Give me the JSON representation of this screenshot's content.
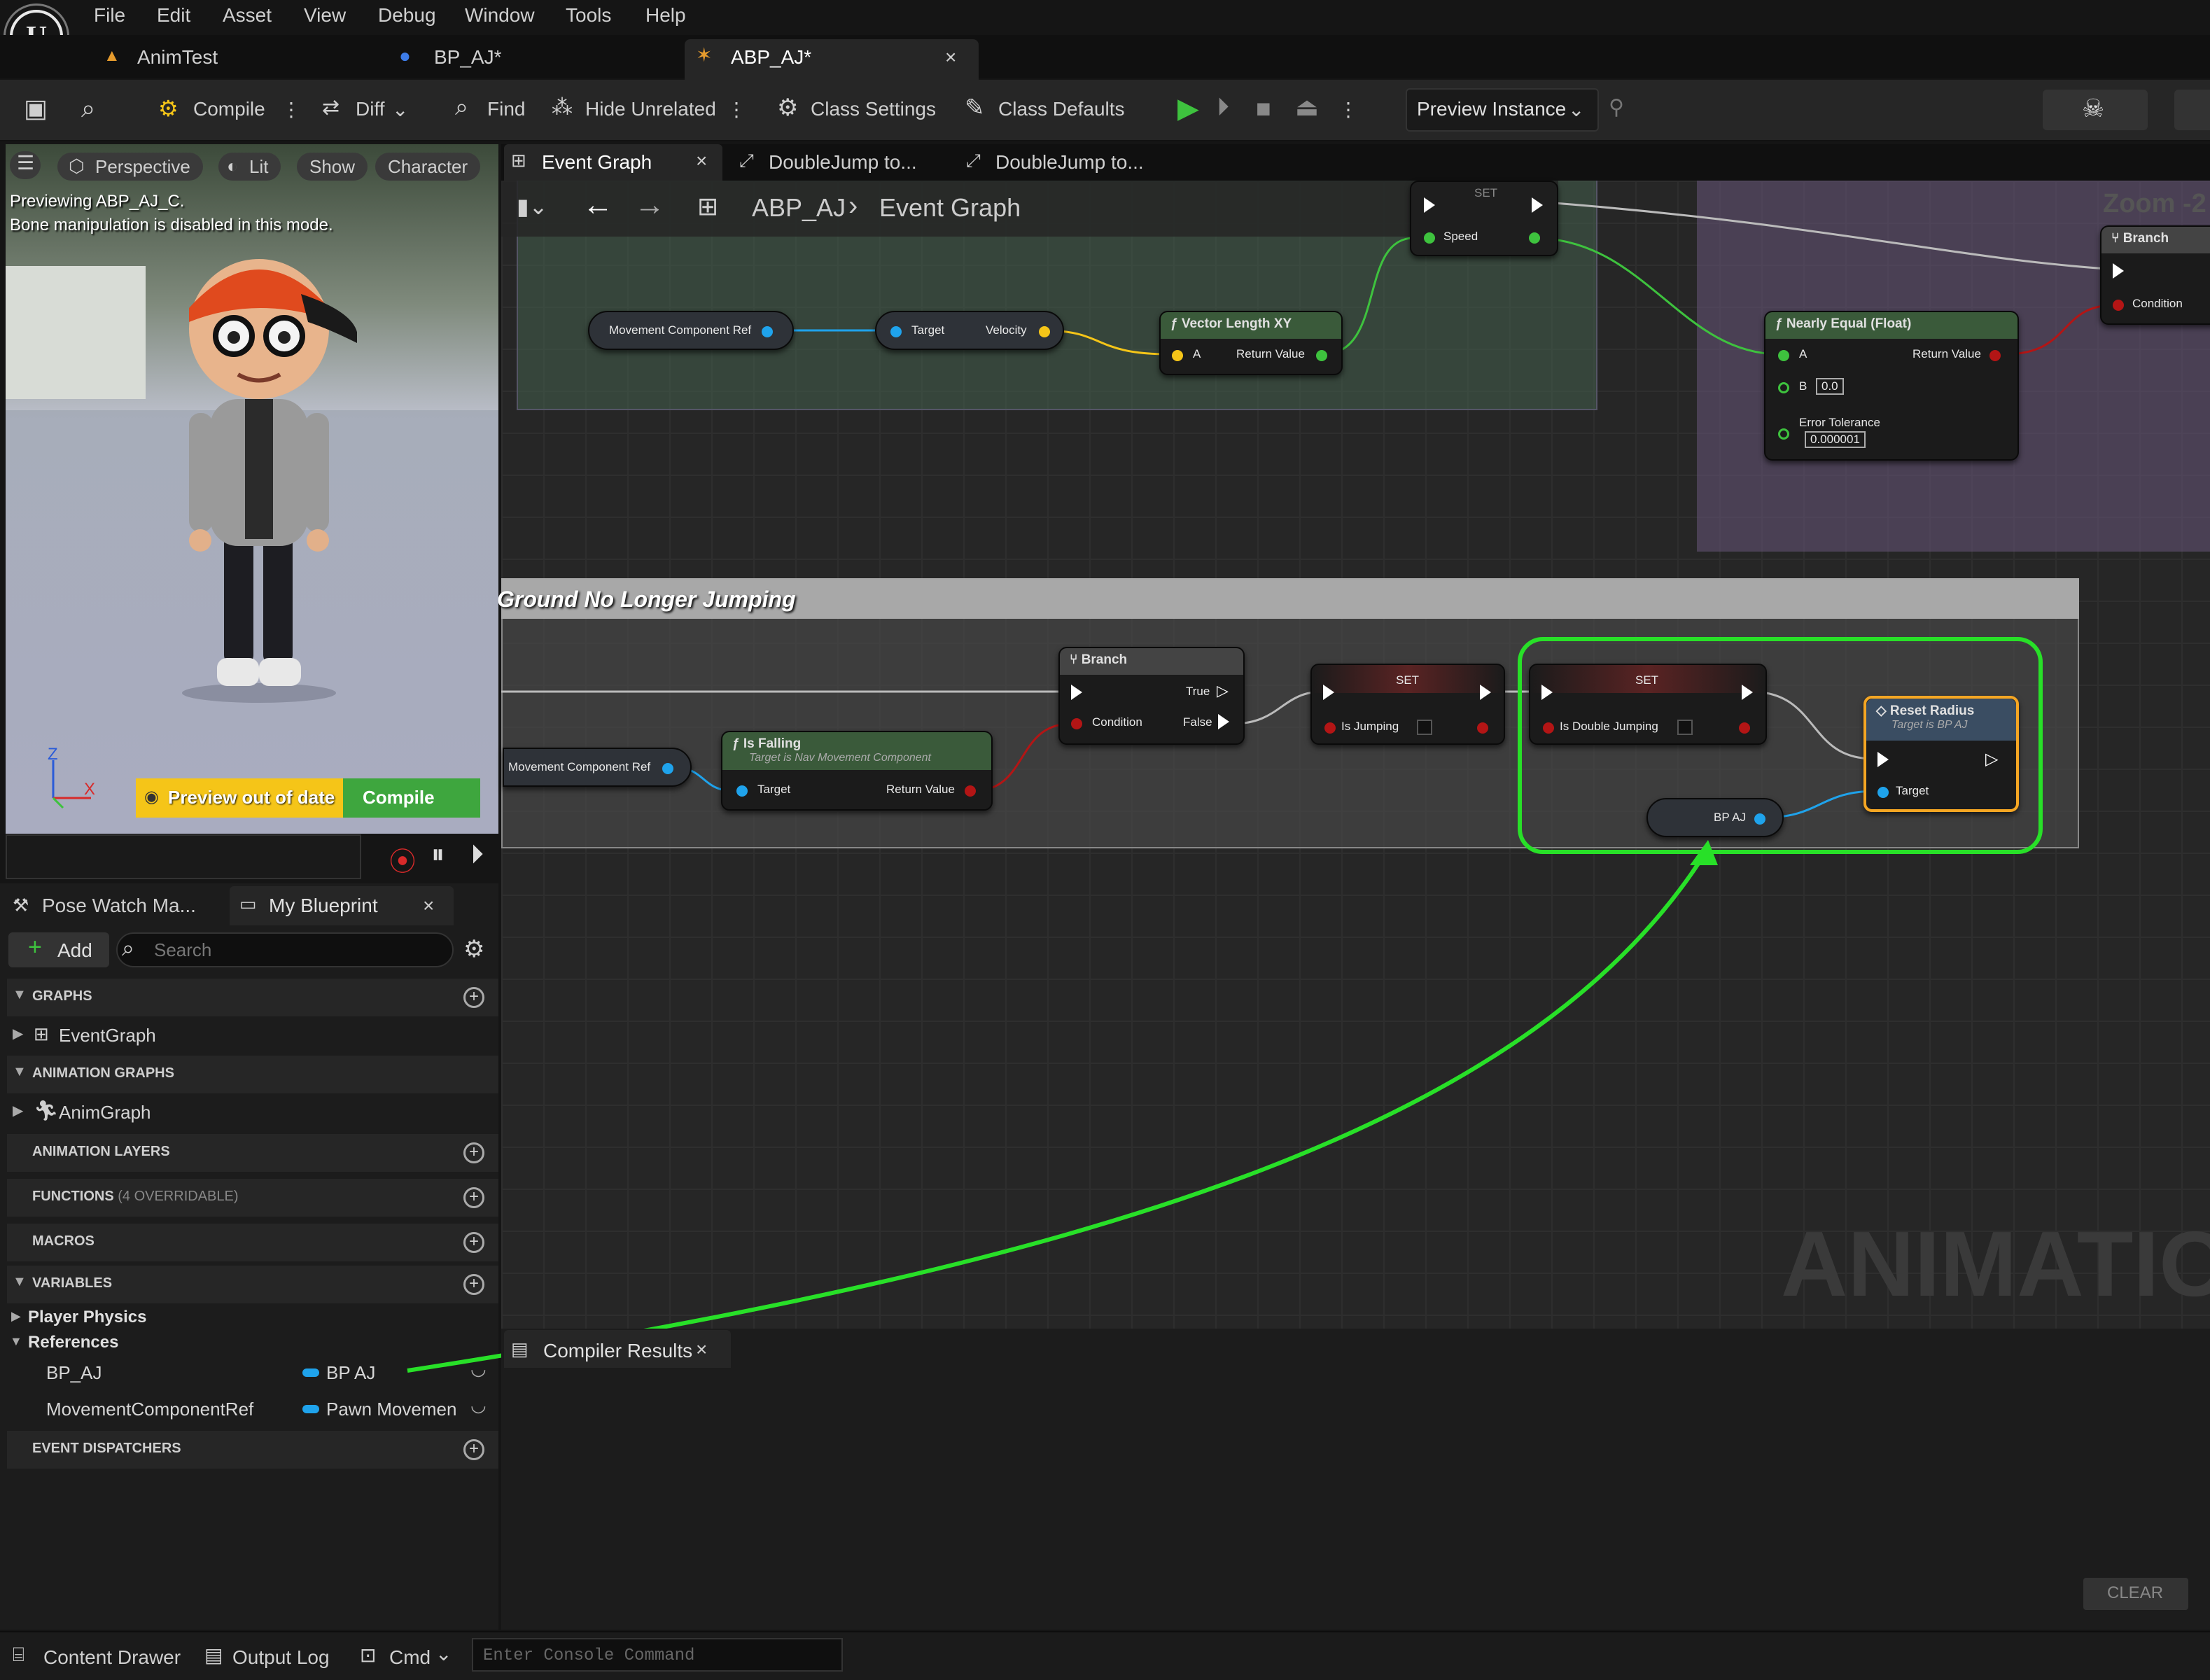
{
  "menu": [
    "File",
    "Edit",
    "Asset",
    "View",
    "Debug",
    "Window",
    "Tools",
    "Help"
  ],
  "doc_tabs": [
    {
      "label": "AnimTest",
      "close": ""
    },
    {
      "label": "BP_AJ*",
      "close": ""
    },
    {
      "label": "ABP_AJ*",
      "close": "×"
    }
  ],
  "toolbar": {
    "compile": "Compile",
    "diff": "Diff",
    "find": "Find",
    "hide_unrelated": "Hide Unrelated",
    "class_settings": "Class Settings",
    "class_defaults": "Class Defaults",
    "preview_instance": "Preview Instance"
  },
  "viewport": {
    "pills": [
      "Perspective",
      "Lit",
      "Show",
      "Character"
    ],
    "preview_line1": "Previewing ABP_AJ_C.",
    "preview_line2": "Bone manipulation is disabled in this mode.",
    "out_of_date": "Preview out of date",
    "compile": "Compile",
    "axis_z": "Z",
    "axis_x": "X"
  },
  "left_tabs": {
    "pose_watch": "Pose Watch Ma...",
    "my_blueprint": "My Blueprint",
    "close": "×"
  },
  "blueprint": {
    "add": "Add",
    "search_placeholder": "Search",
    "graphs": "GRAPHS",
    "event_graph": "EventGraph",
    "anim_graphs": "ANIMATION GRAPHS",
    "anim_graph": "AnimGraph",
    "anim_layers": "ANIMATION LAYERS",
    "functions": "FUNCTIONS",
    "functions_count": "(4 OVERRIDABLE)",
    "macros": "MACROS",
    "variables": "VARIABLES",
    "player_physics": "Player Physics",
    "references": "References",
    "vars": [
      {
        "name": "BP_AJ",
        "type": "BP AJ",
        "color": "#1fa3ec"
      },
      {
        "name": "MovementComponentRef",
        "type": "Pawn Movemen",
        "color": "#1fa3ec"
      }
    ],
    "event_dispatchers": "EVENT DISPATCHERS"
  },
  "graph_tabs": {
    "event_graph": "Event Graph",
    "close": "×",
    "dj1": "DoubleJump to...",
    "dj2": "DoubleJump to..."
  },
  "breadcrumb": {
    "root": "ABP_AJ",
    "sep": "›",
    "current": "Event Graph"
  },
  "zoom": "Zoom -2",
  "watermark": "ANIMATION",
  "comment_title": "Ground No Longer Jumping",
  "nodes": {
    "set_top": {
      "title": "SET",
      "pin": "Speed"
    },
    "mcr1": "Movement Component Ref",
    "velocity": {
      "in": "Target",
      "out": "Velocity"
    },
    "vlen": {
      "title": "Vector Length XY",
      "in": "A",
      "out": "Return Value"
    },
    "nearly": {
      "title": "Nearly Equal (Float)",
      "a": "A",
      "b": "B",
      "b_val": "0.0",
      "tol": "Error Tolerance",
      "tol_val": "0.000001",
      "out": "Return Value"
    },
    "branch_top": {
      "title": "Branch",
      "cond": "Condition"
    },
    "mcr2": "Movement Component Ref",
    "isfalling": {
      "title": "Is Falling",
      "sub": "Target is Nav Movement Component",
      "in": "Target",
      "out": "Return Value"
    },
    "branch": {
      "title": "Branch",
      "cond": "Condition",
      "t": "True",
      "f": "False"
    },
    "set1": {
      "title": "SET",
      "pin": "Is Jumping"
    },
    "set2": {
      "title": "SET",
      "pin": "Is Double Jumping"
    },
    "bpaj": "BP AJ",
    "reset": {
      "title": "Reset Radius",
      "sub": "Target is BP AJ",
      "pin": "Target"
    }
  },
  "compiler": {
    "tab": "Compiler Results",
    "close": "×",
    "clear": "CLEAR"
  },
  "bottom": {
    "drawer": "Content Drawer",
    "output": "Output Log",
    "cmd": "Cmd",
    "console_placeholder": "Enter Console Command"
  },
  "colors": {
    "exec": "#ffffff",
    "bool": "#8c0000",
    "float": "#3ec23e",
    "vector": "#f5c518",
    "object": "#1fa3ec",
    "highlight": "#28e028",
    "selected": "#f5a623"
  }
}
